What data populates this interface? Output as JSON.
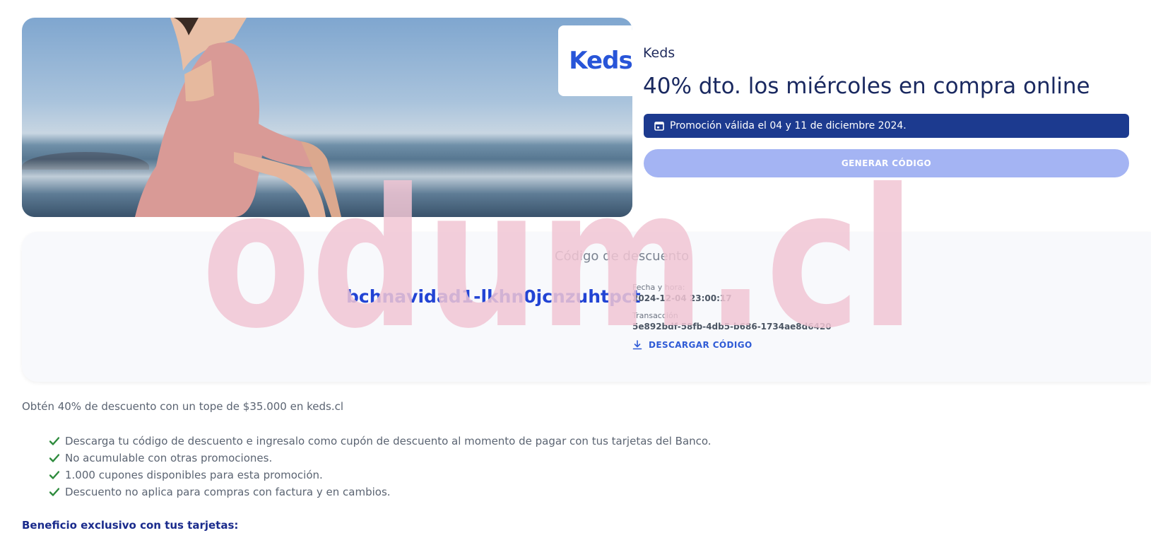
{
  "promo": {
    "logo_text": "Keds",
    "brand": "Keds",
    "title": "40% dto. los miércoles en compra online",
    "validity": "Promoción válida el 04 y 11 de diciembre 2024.",
    "generate_button": "GENERAR CÓDIGO"
  },
  "code": {
    "label": "Código de descuento",
    "value": "bchnavidad1-lkhn0jcnzuhtpct",
    "datetime_label": "Fecha y hora:",
    "datetime_value": "2024-12-04 23:00:17",
    "transaction_label": "Transacción",
    "transaction_value": "5e892bdf-58fb-4db5-b686-1734ae8d6420",
    "download_label": "DESCARGAR CÓDIGO"
  },
  "details": {
    "intro": "Obtén 40% de descuento con un tope de $35.000 en keds.cl",
    "bullets": [
      "Descarga tu código de descuento e ingresalo como cupón de descuento al momento de pagar con tus tarjetas del Banco.",
      "No acumulable con otras promociones.",
      "1.000 cupones disponibles para esta promoción.",
      "Descuento no aplica para compras con factura y en cambios."
    ],
    "exclusive": "Beneficio exclusivo con tus tarjetas:"
  },
  "watermark": "odum.cl",
  "colors": {
    "primary": "#1c3a8f",
    "accent": "#2244d4",
    "button_disabled": "#a4b4f3",
    "check": "#2e8b3d",
    "watermark": "#f1c6d4"
  },
  "icons": {
    "validity": "calendar-icon",
    "download": "download-icon",
    "bullet": "check-icon"
  }
}
